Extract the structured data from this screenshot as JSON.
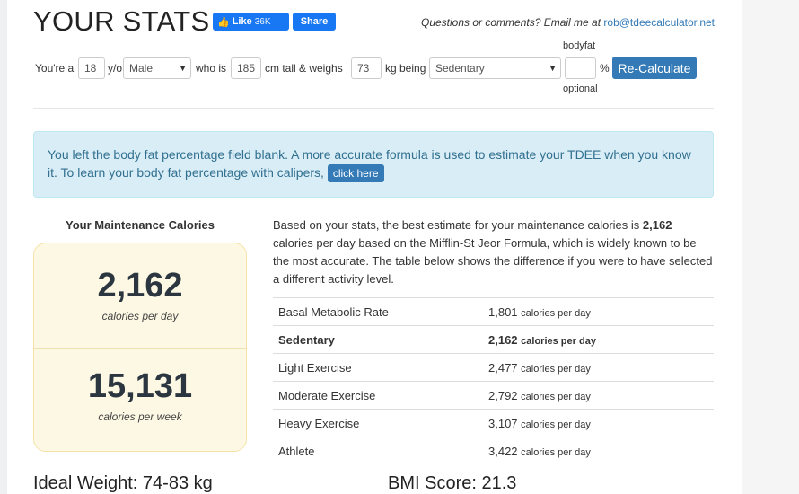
{
  "header": {
    "title": "YOUR STATS",
    "fb_like": "Like",
    "fb_like_count": "36K",
    "fb_share": "Share",
    "contact_text": "Questions or comments? Email me at",
    "contact_email": "rob@tdeecalculator.net"
  },
  "form": {
    "youre_a": "You're a",
    "age": "18",
    "yo": "y/o",
    "gender": "Male",
    "who_is": "who is",
    "height": "185",
    "cm_tall": "cm tall & weighs",
    "weight": "73",
    "kg_being": "kg being",
    "activity": "Sedentary",
    "bodyfat_label_top": "bodyfat",
    "bodyfat_value": "",
    "percent": "%",
    "bodyfat_label_bottom": "optional",
    "recalc_button": "Re-Calculate"
  },
  "alert": {
    "text": "You left the body fat percentage field blank. A more accurate formula is used to estimate your TDEE when you know it. To learn your body fat percentage with calipers,",
    "button": "click here"
  },
  "maintenance": {
    "title": "Your Maintenance Calories",
    "per_day_value": "2,162",
    "per_day_label": "calories per day",
    "per_week_value": "15,131",
    "per_week_label": "calories per week"
  },
  "description": {
    "part1": "Based on your stats, the best estimate for your maintenance calories is",
    "calories": "2,162",
    "part2": "calories per day based on the Mifflin-St Jeor Formula, which is widely known to be the most accurate. The table below shows the difference if you were to have selected a different activity level."
  },
  "activity_table": {
    "unit": "calories per day",
    "rows": [
      {
        "label": "Basal Metabolic Rate",
        "value": "1,801"
      },
      {
        "label": "Sedentary",
        "value": "2,162"
      },
      {
        "label": "Light Exercise",
        "value": "2,477"
      },
      {
        "label": "Moderate Exercise",
        "value": "2,792"
      },
      {
        "label": "Heavy Exercise",
        "value": "3,107"
      },
      {
        "label": "Athlete",
        "value": "3,422"
      }
    ]
  },
  "footer": {
    "ideal_weight": "Ideal Weight: 74-83 kg",
    "bmi_score": "BMI Score: 21.3"
  },
  "colors": {
    "primary": "#337ab7",
    "facebook": "#1877f2",
    "alert_bg": "#d9edf7",
    "calorie_box_bg": "#fcf8e3"
  }
}
